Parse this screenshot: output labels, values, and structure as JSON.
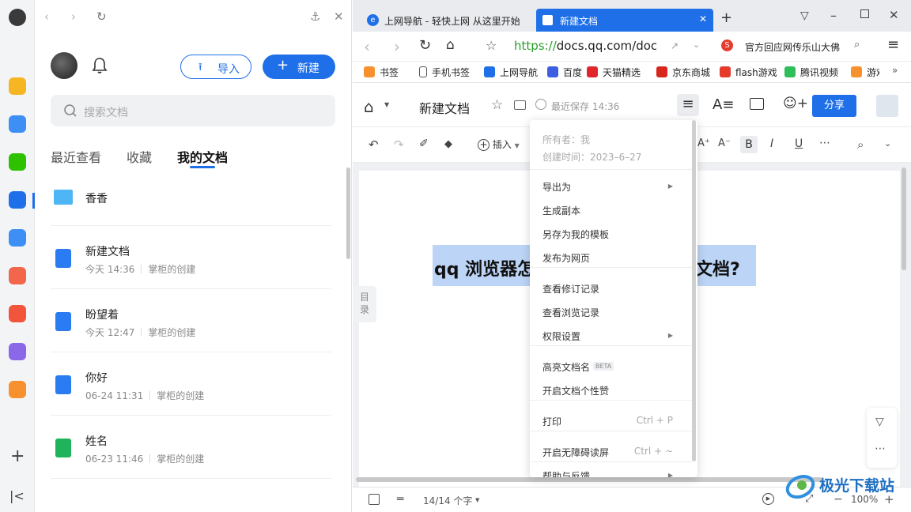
{
  "rail": {
    "apps": [
      {
        "name": "star-app-icon",
        "color": "#f6b624"
      },
      {
        "name": "clock-app-icon",
        "color": "#3d8ff5"
      },
      {
        "name": "wechat-app-icon",
        "color": "#2dc100"
      },
      {
        "name": "plane-app-icon",
        "color": "#1f6fe8"
      },
      {
        "name": "cloud-app-icon",
        "color": "#3d8ff5"
      },
      {
        "name": "translate-app-icon",
        "color": "#f2664b"
      },
      {
        "name": "pdf-app-icon",
        "color": "#f2553c"
      },
      {
        "name": "edit-app-icon",
        "color": "#8a68e8"
      },
      {
        "name": "search-app-icon",
        "color": "#f7912f"
      }
    ]
  },
  "panel": {
    "import_label": "导入",
    "new_label": "新建",
    "search_placeholder": "搜索文档",
    "tabs": [
      "最近查看",
      "收藏",
      "我的文档"
    ],
    "active_tab": "我的文档",
    "folder": {
      "name": "香香"
    },
    "docs": [
      {
        "title": "新建文档",
        "time": "今天 14:36",
        "owner": "掌柜的创建",
        "kind": "doc"
      },
      {
        "title": "盼望着",
        "time": "今天 12:47",
        "owner": "掌柜的创建",
        "kind": "doc"
      },
      {
        "title": "你好",
        "time": "06-24 11:31",
        "owner": "掌柜的创建",
        "kind": "doc"
      },
      {
        "title": "姓名",
        "time": "06-23 11:46",
        "owner": "掌柜的创建",
        "kind": "sheet"
      }
    ]
  },
  "browser": {
    "tabs": [
      {
        "title": "上网导航 - 轻快上网 从这里开始",
        "active": false
      },
      {
        "title": "新建文档",
        "active": true
      }
    ],
    "url_https": "https://",
    "url_rest": "docs.qq.com/doc/D",
    "search_text": "官方回应网传乐山大佛",
    "bookmarks": [
      "书签",
      "手机书签",
      "上网导航",
      "百度",
      "天猫精选",
      "京东商城",
      "flash游戏",
      "腾讯视频",
      "游戏"
    ]
  },
  "doc": {
    "title": "新建文档",
    "saved": "最近保存 14:36",
    "share_label": "分享",
    "insert_label": "插入",
    "content_left": "qq 浏览器怎",
    "content_right": "文档?",
    "toc_label": "目录",
    "status_count": "14/14 个字",
    "zoom": "100%"
  },
  "menu": {
    "owner": "所有者：我",
    "created": "创建时间：2023–6–27",
    "items": [
      {
        "label": "导出为",
        "submenu": true
      },
      {
        "label": "生成副本"
      },
      {
        "label": "另存为我的模板"
      },
      {
        "label": "发布为网页"
      },
      {
        "label": "查看修订记录"
      },
      {
        "label": "查看浏览记录"
      },
      {
        "label": "权限设置",
        "submenu": true
      },
      {
        "label": "高亮文档名",
        "badge": "BETA"
      },
      {
        "label": "开启文档个性赞"
      },
      {
        "label": "打印",
        "shortcut": "Ctrl + P"
      },
      {
        "label": "开启无障碍读屏",
        "shortcut": "Ctrl + ~"
      },
      {
        "label": "帮助与反馈",
        "submenu": true
      }
    ]
  },
  "watermark": "极光下载站",
  "colors": {
    "accent": "#1f6fe8",
    "highlight": "#bcd4f5"
  }
}
